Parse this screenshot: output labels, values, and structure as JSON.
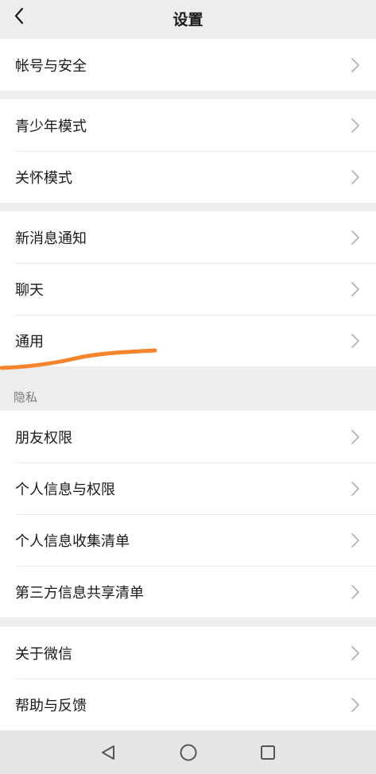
{
  "header": {
    "title": "设置",
    "back_icon": "back-chevron-icon"
  },
  "groups": [
    {
      "items": [
        {
          "label": "帐号与安全"
        }
      ]
    },
    {
      "items": [
        {
          "label": "青少年模式"
        },
        {
          "label": "关怀模式"
        }
      ]
    },
    {
      "items": [
        {
          "label": "新消息通知"
        },
        {
          "label": "聊天"
        },
        {
          "label": "通用"
        }
      ]
    },
    {
      "items": [
        {
          "label": "朋友权限"
        },
        {
          "label": "个人信息与权限"
        },
        {
          "label": "个人信息收集清单"
        },
        {
          "label": "第三方信息共享清单"
        }
      ]
    },
    {
      "items": [
        {
          "label": "关于微信"
        },
        {
          "label": "帮助与反馈"
        }
      ]
    }
  ],
  "privacy_section": {
    "title": "隐私"
  },
  "annotation": {
    "color": "#f5842c",
    "marks": "通用"
  },
  "navbar": {
    "icons": [
      "back-triangle-icon",
      "home-circle-icon",
      "recents-square-icon"
    ]
  },
  "colors": {
    "background": "#ededed",
    "card": "#ffffff",
    "text": "#191919",
    "chevron": "#b2b2b2"
  }
}
